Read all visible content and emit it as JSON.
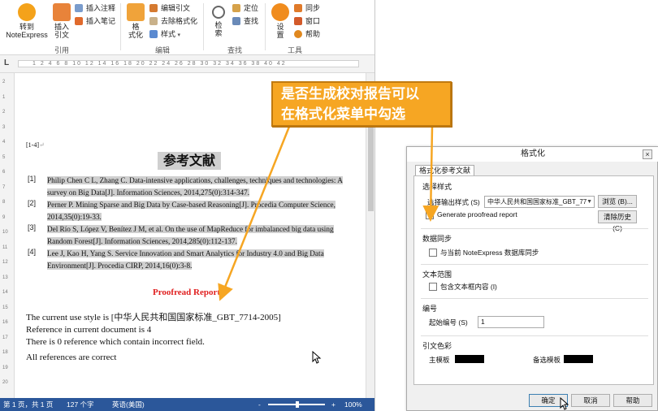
{
  "ribbon": {
    "groups": {
      "cite": "引用",
      "edit": "编辑",
      "find": "查找",
      "tools": "工具"
    },
    "buttons": {
      "goto_ne": "转到\nNoteExpress",
      "insert_cite": "插入\n引文",
      "format": "格\n式化",
      "search": "检\n索",
      "settings": "设\n置"
    },
    "small": {
      "insert_note": "插入注释",
      "insert_pen": "插入笔记",
      "edit_cite": "编辑引文",
      "remove_fmt": "去除格式化",
      "style": "样式",
      "locate": "定位",
      "find": "查找",
      "sync": "同步",
      "window": "窗口",
      "help": "帮助"
    }
  },
  "ruler": {
    "tab_marker": "L",
    "ticks": "1  2  4  6  8  10  12  14  16  18  20  22  24  26  28  30  32  34  36  38  40  42"
  },
  "vruler": {
    "ticks": [
      "2",
      "1",
      "2",
      "3",
      "4",
      "5",
      "6",
      "7",
      "8",
      "9",
      "10",
      "11",
      "12",
      "13",
      "14",
      "15",
      "16",
      "17",
      "18",
      "19",
      "20"
    ]
  },
  "document": {
    "cite_tag": "[1-4]",
    "title": "参考文献",
    "references": [
      {
        "idx": "[1]",
        "line1": "Philip Chen C L, Zhang C. Data-intensive applications, challenges, techniques and technologies: A",
        "line2": "survey on Big Data[J]. Information Sciences, 2014,275(0):314-347."
      },
      {
        "idx": "[2]",
        "line1": "Perner P. Mining Sparse and Big Data by Case-based Reasoning[J]. Procedia Computer Science,",
        "line2": "2014,35(0):19-33."
      },
      {
        "idx": "[3]",
        "line1": "Del Río S, López V, Benítez J M, et al. On the use of MapReduce for imbalanced big data using",
        "line2": "Random Forest[J]. Information Sciences, 2014,285(0):112-137."
      },
      {
        "idx": "[4]",
        "line1": "Lee J, Kao H, Yang S. Service Innovation and Smart Analytics for Industry 4.0 and Big Data",
        "line2": "Environment[J]. Procedia CIRP, 2014,16(0):3-8."
      }
    ],
    "proof_title": "Proofread Report",
    "style_line": "The current use style is [中华人民共和国国家标准_GBT_7714-2005]",
    "ref_count_line": "Reference in current document is 4",
    "incorrect_line": "There is 0 reference which contain incorrect field.",
    "correct_line": "All references are correct"
  },
  "status": {
    "page": "第 1 页，共 1 页",
    "words": "127 个字",
    "lang": "英语(美国)",
    "zoom": "100%",
    "minus": "-",
    "plus": "+"
  },
  "callout": {
    "line1": "是否生成校对报告可以",
    "line2": "在格式化菜单中勾选"
  },
  "dialog": {
    "title": "格式化",
    "close": "×",
    "tab": "格式化参考文献",
    "sec_style": "选择样式",
    "select_style_label": "选择输出样式 (S)",
    "style_value": "中华人民共和国国家标准_GBT_77",
    "browse": "浏览 (B)...",
    "clear_history": "清除历史 (C)",
    "gen_proof_label": "Generate proofread report",
    "gen_proof_checked": "✓",
    "sec_sync": "数据同步",
    "sync_label": "与当前 NoteExpress 数据库同步",
    "sec_text": "文本范围",
    "textbox_label": "包含文本框内容 (I)",
    "sec_num": "编号",
    "start_num_label": "起始编号 (S)",
    "start_num_value": "1",
    "sec_color": "引文色彩",
    "main_tpl": "主模板",
    "alt_tpl": "备选模板",
    "swatch_color": "#000000",
    "ok": "确定",
    "cancel": "取消",
    "help": "帮助"
  },
  "colors": {
    "accent": "#2b579a",
    "callout": "#f6a623",
    "proof": "#e02020"
  }
}
